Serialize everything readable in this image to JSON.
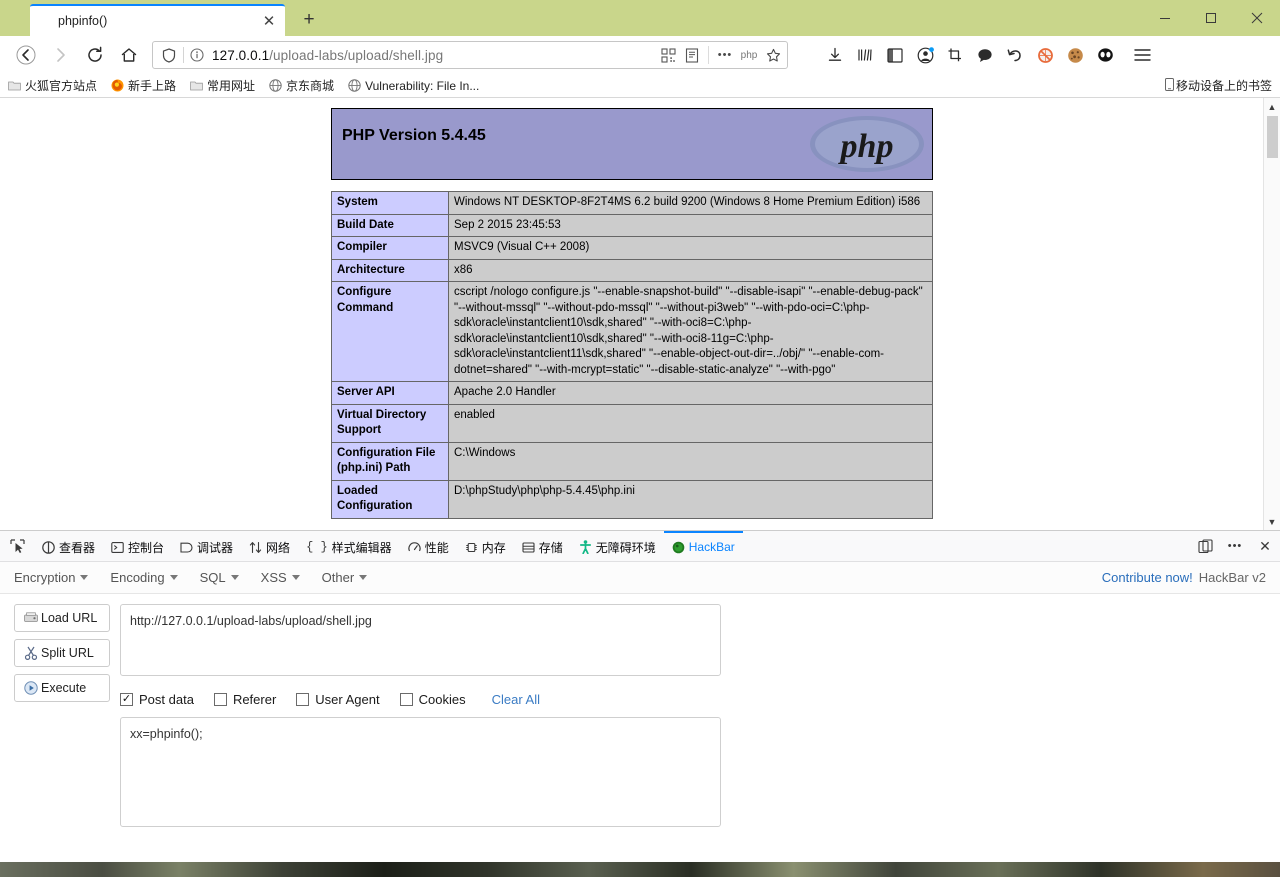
{
  "window": {
    "minimize_label": "Minimize",
    "maximize_label": "Maximize",
    "close_label": "Close",
    "titlebar_color": "#c9d68b"
  },
  "tabs": [
    {
      "title": "phpinfo()",
      "close_glyph": "✕"
    }
  ],
  "new_tab_glyph": "+",
  "navbar": {
    "back_glyph": "←",
    "forward_glyph": "→",
    "reload_glyph": "⟳",
    "home_glyph": "⌂",
    "url_prefix": "127.0.0.1",
    "url_suffix": "/upload-labs/upload/shell.jpg",
    "url_full": "127.0.0.1/upload-labs/upload/shell.jpg",
    "php_badge": "php",
    "more_glyph": "•••",
    "star_glyph": "☆",
    "menu_glyph": "☰"
  },
  "bookmarks": {
    "items": [
      {
        "label": "火狐官方站点",
        "icon": "folder-icon"
      },
      {
        "label": "新手上路",
        "icon": "firefox-icon"
      },
      {
        "label": "常用网址",
        "icon": "folder-icon"
      },
      {
        "label": "京东商城",
        "icon": "globe-icon"
      },
      {
        "label": "Vulnerability: File In...",
        "icon": "globe-icon"
      }
    ],
    "mobile_label": "移动设备上的书签"
  },
  "phpinfo": {
    "version_title": "PHP Version 5.4.45",
    "logo_text": "php",
    "rows": [
      {
        "key": "System",
        "value": "Windows NT DESKTOP-8F2T4MS 6.2 build 9200 (Windows 8 Home Premium Edition) i586"
      },
      {
        "key": "Build Date",
        "value": "Sep 2 2015 23:45:53"
      },
      {
        "key": "Compiler",
        "value": "MSVC9 (Visual C++ 2008)"
      },
      {
        "key": "Architecture",
        "value": "x86"
      },
      {
        "key": "Configure Command",
        "value": "cscript /nologo configure.js \"--enable-snapshot-build\" \"--disable-isapi\" \"--enable-debug-pack\" \"--without-mssql\" \"--without-pdo-mssql\" \"--without-pi3web\" \"--with-pdo-oci=C:\\php-sdk\\oracle\\instantclient10\\sdk,shared\" \"--with-oci8=C:\\php-sdk\\oracle\\instantclient10\\sdk,shared\" \"--with-oci8-11g=C:\\php-sdk\\oracle\\instantclient11\\sdk,shared\" \"--enable-object-out-dir=../obj/\" \"--enable-com-dotnet=shared\" \"--with-mcrypt=static\" \"--disable-static-analyze\" \"--with-pgo\""
      },
      {
        "key": "Server API",
        "value": "Apache 2.0 Handler"
      },
      {
        "key": "Virtual Directory Support",
        "value": "enabled"
      },
      {
        "key": "Configuration File (php.ini) Path",
        "value": "C:\\Windows"
      },
      {
        "key": "Loaded Configuration",
        "value": "D:\\phpStudy\\php\\php-5.4.45\\php.ini"
      }
    ]
  },
  "devtools": {
    "tabs": [
      {
        "label": "查看器",
        "icon": "inspector-icon",
        "active": false
      },
      {
        "label": "控制台",
        "icon": "console-icon",
        "active": false
      },
      {
        "label": "调试器",
        "icon": "debugger-icon",
        "active": false
      },
      {
        "label": "网络",
        "icon": "network-icon",
        "active": false
      },
      {
        "label": "样式编辑器",
        "icon": "style-editor-icon",
        "active": false
      },
      {
        "label": "性能",
        "icon": "performance-icon",
        "active": false
      },
      {
        "label": "内存",
        "icon": "memory-icon",
        "active": false
      },
      {
        "label": "存储",
        "icon": "storage-icon",
        "active": false
      },
      {
        "label": "无障碍环境",
        "icon": "accessibility-icon",
        "active": false
      },
      {
        "label": "HackBar",
        "icon": "hackbar-icon",
        "active": true
      }
    ],
    "active_color": "#0a84ff",
    "dock_glyph": "❐",
    "more_glyph": "•••",
    "close_glyph": "✕"
  },
  "hackbar": {
    "menus": [
      {
        "label": "Encryption"
      },
      {
        "label": "Encoding"
      },
      {
        "label": "SQL"
      },
      {
        "label": "XSS"
      },
      {
        "label": "Other"
      }
    ],
    "contribute_label": "Contribute now!",
    "version_label": "HackBar v2",
    "buttons": [
      {
        "label": "Load URL",
        "icon": "load-url-icon"
      },
      {
        "label": "Split URL",
        "icon": "split-url-icon"
      },
      {
        "label": "Execute",
        "icon": "execute-icon"
      }
    ],
    "url_value": "http://127.0.0.1/upload-labs/upload/shell.jpg",
    "url_placeholder": "",
    "checkboxes": [
      {
        "label": "Post data",
        "checked": true
      },
      {
        "label": "Referer",
        "checked": false
      },
      {
        "label": "User Agent",
        "checked": false
      },
      {
        "label": "Cookies",
        "checked": false
      }
    ],
    "check_glyph": "✓",
    "clear_all_label": "Clear All",
    "postdata_value": "xx=phpinfo();",
    "postdata_placeholder": ""
  }
}
